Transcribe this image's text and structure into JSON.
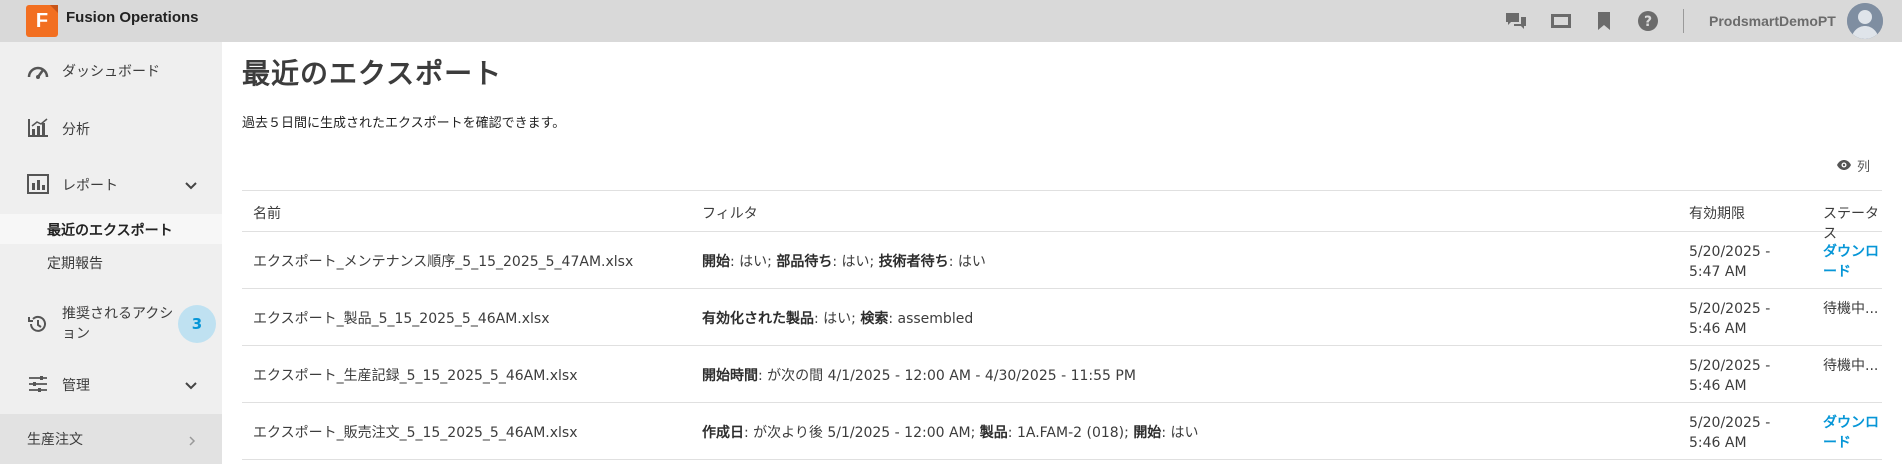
{
  "app": {
    "logo_letter": "F",
    "title": "Fusion Operations",
    "user_name": "ProdsmartDemoPT",
    "brand_color": "#f26f21",
    "accent_color": "#0696d7"
  },
  "topbar_icons": [
    "chat-icon",
    "slides-icon",
    "bookmark-icon",
    "help-icon"
  ],
  "sidebar": {
    "items": [
      {
        "label": "ダッシュボード",
        "icon": "dashboard-icon"
      },
      {
        "label": "分析",
        "icon": "analytics-icon"
      },
      {
        "label": "レポート",
        "icon": "report-icon"
      },
      {
        "label": "推奨されるアクション",
        "icon": "history-icon",
        "badge": "3"
      },
      {
        "label": "管理",
        "icon": "sliders-icon"
      }
    ],
    "report_subitems": [
      {
        "label": "最近のエクスポート",
        "active": true
      },
      {
        "label": "定期報告",
        "active": false
      }
    ],
    "bottom_item": {
      "label": "生産注文"
    }
  },
  "main": {
    "title": "最近のエクスポート",
    "description": "過去５日間に生成されたエクスポートを確認できます。",
    "columns_button": "列",
    "table": {
      "headers": [
        "名前",
        "フィルタ",
        "有効期限",
        "ステータス"
      ],
      "rows": [
        {
          "name": "エクスポート_メンテナンス順序_5_15_2025_5_47AM.xlsx",
          "filters": [
            {
              "key": "開始",
              "value": ": はい; "
            },
            {
              "key": "部品待ち",
              "value": ": はい; "
            },
            {
              "key": "技術者待ち",
              "value": ": はい"
            }
          ],
          "expiry": "5/20/2025 - 5:47 AM",
          "status": "ダウンロード",
          "status_is_link": true
        },
        {
          "name": "エクスポート_製品_5_15_2025_5_46AM.xlsx",
          "filters": [
            {
              "key": "有効化された製品",
              "value": ": はい; "
            },
            {
              "key": "検索",
              "value": ": assembled"
            }
          ],
          "expiry": "5/20/2025 - 5:46 AM",
          "status": "待機中...",
          "status_is_link": false
        },
        {
          "name": "エクスポート_生産記録_5_15_2025_5_46AM.xlsx",
          "filters": [
            {
              "key": "開始時間",
              "value": ": が次の間 4/1/2025 - 12:00 AM - 4/30/2025 - 11:55 PM"
            }
          ],
          "expiry": "5/20/2025 - 5:46 AM",
          "status": "待機中...",
          "status_is_link": false
        },
        {
          "name": "エクスポート_販売注文_5_15_2025_5_46AM.xlsx",
          "filters": [
            {
              "key": "作成日",
              "value": ": が次より後 5/1/2025 - 12:00 AM; "
            },
            {
              "key": "製品",
              "value": ": 1A.FAM-2 (018); "
            },
            {
              "key": "開始",
              "value": ": はい"
            }
          ],
          "expiry": "5/20/2025 - 5:46 AM",
          "status": "ダウンロード",
          "status_is_link": true
        }
      ]
    }
  }
}
